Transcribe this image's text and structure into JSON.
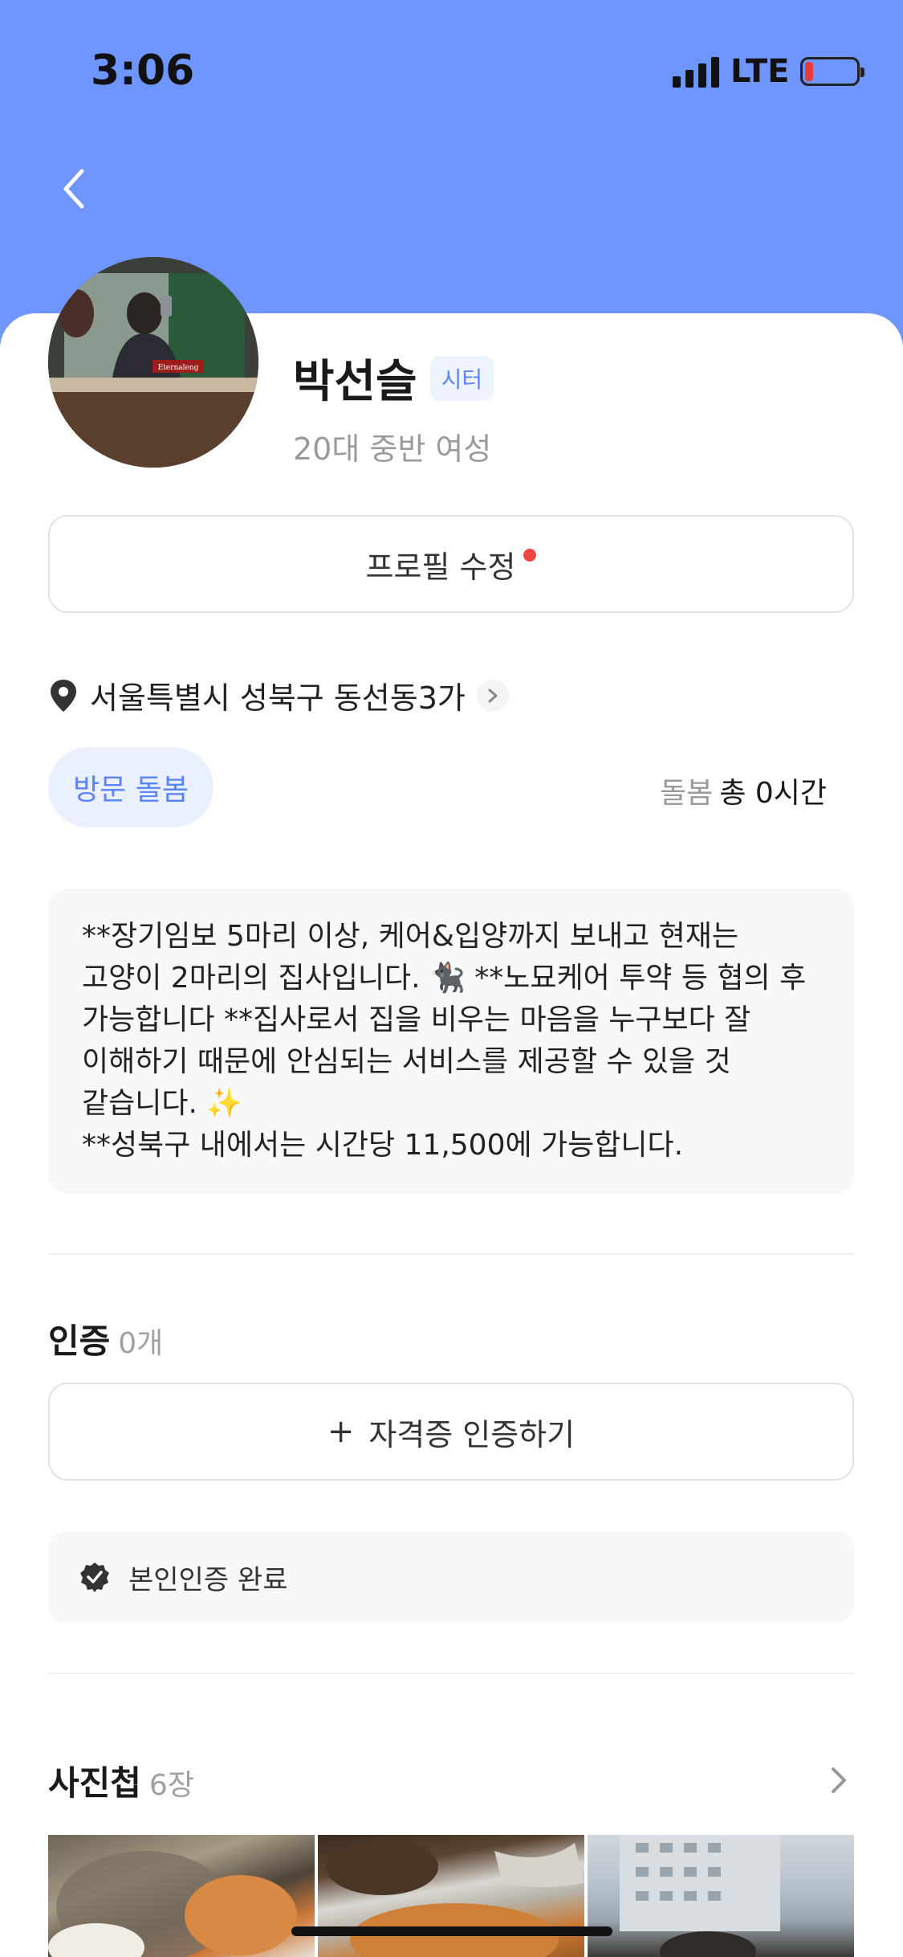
{
  "status_bar": {
    "time": "3:06",
    "network": "LTE"
  },
  "colors": {
    "header_bg": "#6f96ff",
    "accent": "#5b86f7",
    "notification_dot": "#f04545"
  },
  "profile": {
    "name": "박선슬",
    "role_badge": "시터",
    "age_gender": "20대 중반 여성",
    "avatar_sign_text": "Eternaleng"
  },
  "edit_button": {
    "label": "프로필 수정"
  },
  "location": {
    "address": "서울특별시 성북구 동선동3가"
  },
  "service": {
    "type_label": "방문 돌봄",
    "hours_label": "돌봄",
    "hours_value": "총 0시간"
  },
  "intro": {
    "text": "**장기임보 5마리 이상, 케어&입양까지 보내고 현재는 고양이 2마리의 집사입니다. 🐈‍⬛ **노묘케어 투약 등 협의 후 가능합니다 **집사로서 집을 비우는 마음을 누구보다 잘 이해하기 때문에 안심되는 서비스를 제공할 수 있을 것 같습니다. ✨\n**성북구 내에서는 시간당 11,500에 가능합니다."
  },
  "certification": {
    "title": "인증",
    "count": "0개",
    "add_button": "자격증 인증하기",
    "identity_status": "본인인증 완료"
  },
  "album": {
    "title": "사진첩",
    "count": "6장",
    "photos": [
      "cat-photo-1",
      "cat-photo-2",
      "cat-photo-3"
    ]
  }
}
